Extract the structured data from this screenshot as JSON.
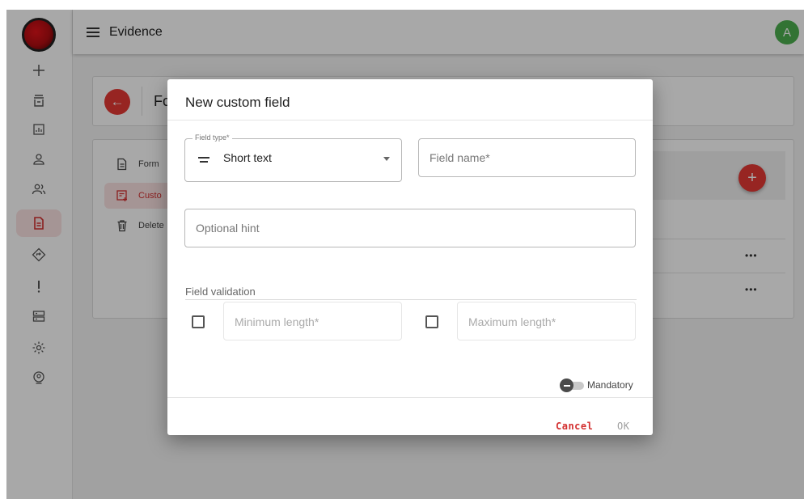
{
  "header": {
    "title": "Evidence",
    "avatar_letter": "A"
  },
  "sidebar": {
    "items": [
      {
        "icon": "plus-icon",
        "active": false
      },
      {
        "icon": "inbox-icon",
        "active": false
      },
      {
        "icon": "chart-icon",
        "active": false
      },
      {
        "icon": "user-icon",
        "active": false
      },
      {
        "icon": "users-icon",
        "active": false
      },
      {
        "icon": "document-icon",
        "active": true
      },
      {
        "icon": "diamond-icon",
        "active": false
      },
      {
        "icon": "alert-icon",
        "active": false
      },
      {
        "icon": "server-icon",
        "active": false
      },
      {
        "icon": "gear-icon",
        "active": false
      },
      {
        "icon": "badge-icon",
        "active": false
      }
    ]
  },
  "background": {
    "page_title_partial": "Fc",
    "side_links": [
      "Form",
      "Custo",
      "Delete"
    ]
  },
  "dialog": {
    "title": "New custom field",
    "field_type": {
      "label": "Field type*",
      "value": "Short text"
    },
    "field_name": {
      "placeholder": "Field name*"
    },
    "hint": {
      "placeholder": "Optional hint"
    },
    "validation": {
      "label": "Field validation",
      "min_placeholder": "Minimum length*",
      "max_placeholder": "Maximum length*"
    },
    "mandatory_label": "Mandatory",
    "cancel_label": "Cancel",
    "ok_label": "OK"
  },
  "colors": {
    "accent": "#e53935",
    "avatar": "#4caf50"
  }
}
